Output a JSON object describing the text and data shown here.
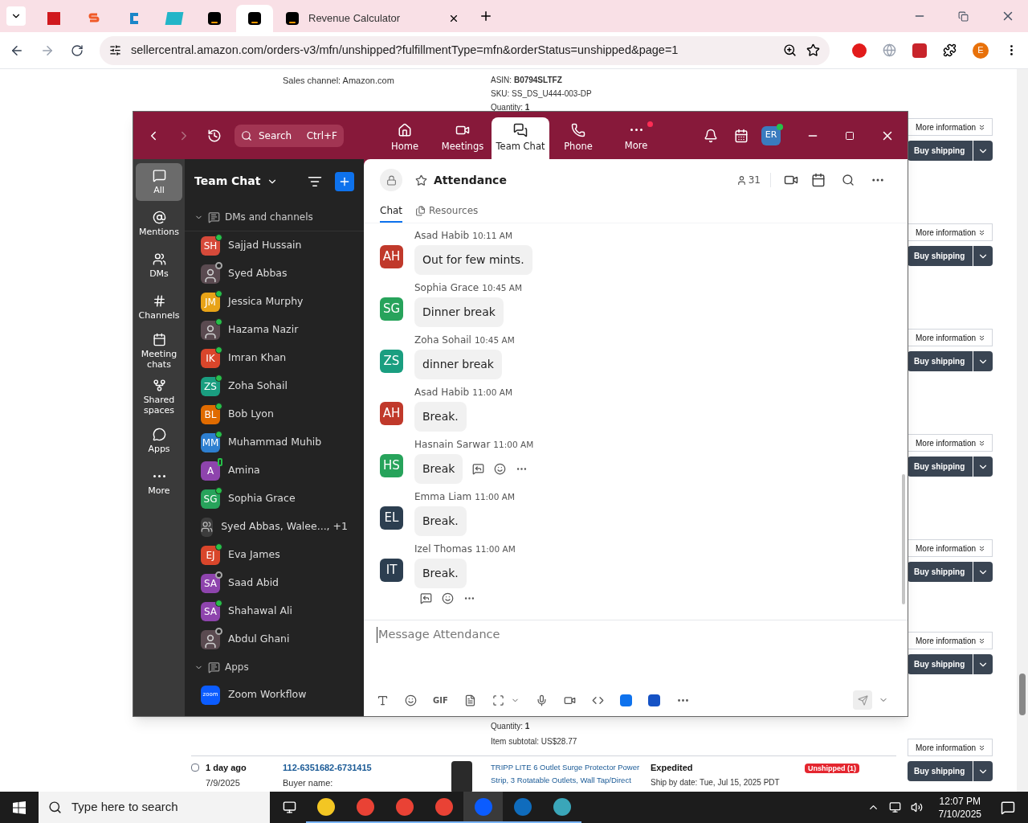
{
  "browser": {
    "tabs": [
      {
        "kind": "pdf",
        "selected": false
      },
      {
        "kind": "s",
        "selected": false
      },
      {
        "kind": "c",
        "selected": false
      },
      {
        "kind": "ec",
        "selected": false
      },
      {
        "kind": "amazon",
        "selected": false
      },
      {
        "kind": "amazon",
        "selected": true
      },
      {
        "kind": "amazon",
        "title": "Revenue Calculator",
        "selected": false
      }
    ],
    "url": "sellercentral.amazon.com/orders-v3/mfn/unshipped?fulfillmentType=mfn&orderStatus=unshipped&page=1",
    "profile": "E"
  },
  "orders_page": {
    "top": {
      "sales_channel": "Sales channel: Amazon.com",
      "asin": "ASIN: **B0794SLTFZ**",
      "sku": "SKU: SS_DS_U444-003-DP",
      "quantity": "Quantity: **1**"
    },
    "actions": [
      {
        "more": "More information",
        "buy": "Buy shipping"
      },
      {
        "more": "More information",
        "buy": "Buy shipping"
      },
      {
        "more": "More information",
        "buy": "Buy shipping"
      },
      {
        "more": "More information",
        "buy": "Buy shipping"
      },
      {
        "more": "More information",
        "buy": "Buy shipping"
      },
      {
        "more": "More information",
        "buy": "Buy shipping"
      }
    ],
    "bottom": {
      "quantity": "Quantity: **1**",
      "subtotal": "Item subtotal: US$28.77",
      "more": "More information"
    },
    "order": {
      "checked": false,
      "age": "1 day ago",
      "date": "7/9/2025",
      "buyer_label": "Buyer name:",
      "order_id": "112-6351682-6731415",
      "product_lines": [
        "TRIPP LITE 6 Outlet Surge Protector Power",
        "Strip, 3 Rotatable Outlets, Wall Tap/Direct"
      ],
      "shipping": "Expedited",
      "ship_by": "Ship by date: Tue, Jul 15, 2025 PDT",
      "status": "Unshipped (1)",
      "buy": "Buy shipping"
    }
  },
  "zoom": {
    "search": {
      "placeholder": "Search",
      "shortcut": "Ctrl+F"
    },
    "nav": [
      {
        "kind": "home",
        "label": "Home",
        "selected": false,
        "badge": false
      },
      {
        "kind": "meetings",
        "label": "Meetings",
        "selected": false,
        "badge": false
      },
      {
        "kind": "chat",
        "label": "Team Chat",
        "selected": true,
        "badge": false
      },
      {
        "kind": "phone",
        "label": "Phone",
        "selected": false,
        "badge": false
      },
      {
        "kind": "more",
        "label": "More",
        "selected": false,
        "badge": true
      }
    ],
    "user": {
      "initials": "ER",
      "online": true
    },
    "rail": [
      {
        "kind": "all",
        "label": "All",
        "selected": true
      },
      {
        "kind": "mentions",
        "label": "Mentions",
        "selected": false
      },
      {
        "kind": "dms",
        "label": "DMs",
        "selected": false
      },
      {
        "kind": "channels",
        "label": "Channels",
        "selected": false
      },
      {
        "kind": "meeting",
        "label": "Meeting chats",
        "selected": false
      },
      {
        "kind": "shared",
        "label": "Shared spaces",
        "selected": false
      },
      {
        "kind": "apps",
        "label": "Apps",
        "selected": false
      },
      {
        "kind": "more",
        "label": "More",
        "selected": false
      }
    ],
    "sidebar": {
      "title": "Team Chat",
      "sections": [
        {
          "label": "DMs and channels",
          "expanded": true,
          "items": [
            {
              "kind": "initials",
              "initials": "SH",
              "name": "Sajjad Hussain",
              "color": "#d64a3a",
              "online": true,
              "mobile": false
            },
            {
              "kind": "photo",
              "name": "Syed Abbas",
              "online": false,
              "mobile": false
            },
            {
              "kind": "initials",
              "initials": "JM",
              "name": "Jessica Murphy",
              "color": "#e8a317",
              "online": true,
              "mobile": false
            },
            {
              "kind": "photo",
              "name": "Hazama Nazir",
              "online": true,
              "mobile": false
            },
            {
              "kind": "initials",
              "initials": "IK",
              "name": "Imran Khan",
              "color": "#d9462b",
              "online": true,
              "mobile": false
            },
            {
              "kind": "initials",
              "initials": "ZS",
              "name": "Zoha Sohail",
              "color": "#1a9e80",
              "online": true,
              "mobile": false
            },
            {
              "kind": "initials",
              "initials": "BL",
              "name": "Bob Lyon",
              "color": "#e06b00",
              "online": true,
              "mobile": false
            },
            {
              "kind": "initials",
              "initials": "MM",
              "name": "Muhammad Muhib",
              "color": "#2d7fd0",
              "online": true,
              "mobile": false
            },
            {
              "kind": "initials",
              "initials": "A",
              "name": "Amina",
              "color": "#8e44ad",
              "online": true,
              "mobile": true
            },
            {
              "kind": "initials",
              "initials": "SG",
              "name": "Sophia Grace",
              "color": "#27a35b",
              "online": true,
              "mobile": false
            },
            {
              "kind": "group",
              "name": "Syed Abbas, Walee..., +1"
            },
            {
              "kind": "initials",
              "initials": "EJ",
              "name": "Eva James",
              "color": "#d9462b",
              "online": true,
              "mobile": false
            },
            {
              "kind": "initials",
              "initials": "SA",
              "name": "Saad Abid",
              "color": "#8e44ad",
              "online": false,
              "mobile": false
            },
            {
              "kind": "initials",
              "initials": "SA",
              "name": "Shahawal Ali",
              "color": "#8e44ad",
              "online": true,
              "mobile": false
            },
            {
              "kind": "photo",
              "name": "Abdul Ghani",
              "online": false,
              "mobile": false
            }
          ]
        },
        {
          "label": "Apps",
          "expanded": true,
          "items": [
            {
              "kind": "app",
              "initials": "zoom",
              "name": "Zoom Workflow",
              "color": "#0b5cff"
            }
          ]
        }
      ]
    },
    "channel": {
      "name": "Attendance",
      "members": "31",
      "tabs": [
        {
          "kind": "chat",
          "label": "Chat",
          "selected": true
        },
        {
          "kind": "resources",
          "label": "Resources",
          "selected": false
        }
      ]
    },
    "messages": [
      {
        "initials": "AH",
        "color": "#c0392b",
        "sender": "Asad Habib",
        "time": "10:11 AM",
        "text": "Out for few mints.",
        "actions": false
      },
      {
        "initials": "SG",
        "color": "#27a35b",
        "sender": "Sophia Grace",
        "time": "10:45 AM",
        "text": "Dinner break",
        "actions": false
      },
      {
        "initials": "ZS",
        "color": "#1a9e80",
        "sender": "Zoha Sohail",
        "time": "10:45 AM",
        "text": "dinner break",
        "actions": false
      },
      {
        "initials": "AH",
        "color": "#c0392b",
        "sender": "Asad Habib",
        "time": "11:00 AM",
        "text": "Break.",
        "actions": false
      },
      {
        "initials": "HS",
        "color": "#27a35b",
        "sender": "Hasnain Sarwar",
        "time": "11:00 AM",
        "text": "Break",
        "actions": true
      },
      {
        "initials": "EL",
        "color": "#2c3e50",
        "sender": "Emma Liam",
        "time": "11:00 AM",
        "text": "Break.",
        "actions": false
      },
      {
        "initials": "IT",
        "color": "#2c3e50",
        "sender": "Izel Thomas",
        "time": "11:00 AM",
        "text": "Break.",
        "actions": false
      }
    ],
    "composer": {
      "placeholder": "Message Attendance",
      "gif": "GIF"
    }
  },
  "taskbar": {
    "search": {
      "placeholder": "Type here to search"
    },
    "time": "12:07 PM",
    "date": "7/10/2025"
  }
}
